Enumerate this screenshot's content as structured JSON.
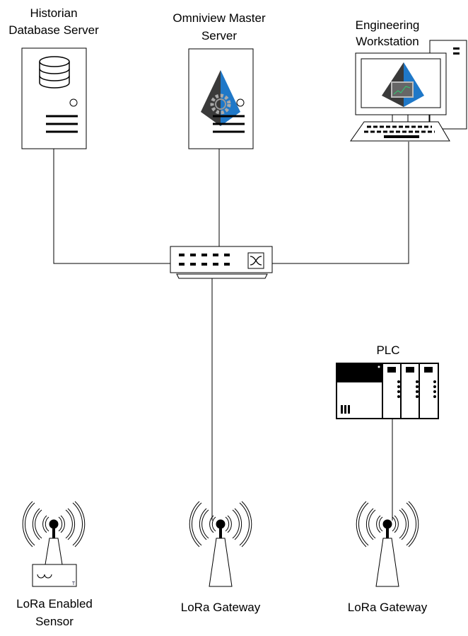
{
  "nodes": {
    "historian": {
      "line1": "Historian",
      "line2": "Database Server"
    },
    "omniview": {
      "line1": "Omniview Master",
      "line2": "Server"
    },
    "workstation": {
      "line1": "Engineering",
      "line2": "Workstation"
    },
    "plc": {
      "label": "PLC"
    },
    "sensor": {
      "line1": "LoRa Enabled",
      "line2": "Sensor",
      "mark": "T"
    },
    "gateway1": {
      "label": "LoRa Gateway"
    },
    "gateway2": {
      "label": "LoRa Gateway"
    }
  },
  "colors": {
    "logo_dark": "#3a3a3a",
    "logo_blue": "#1f78c8",
    "chart_line": "#2ecc71"
  }
}
